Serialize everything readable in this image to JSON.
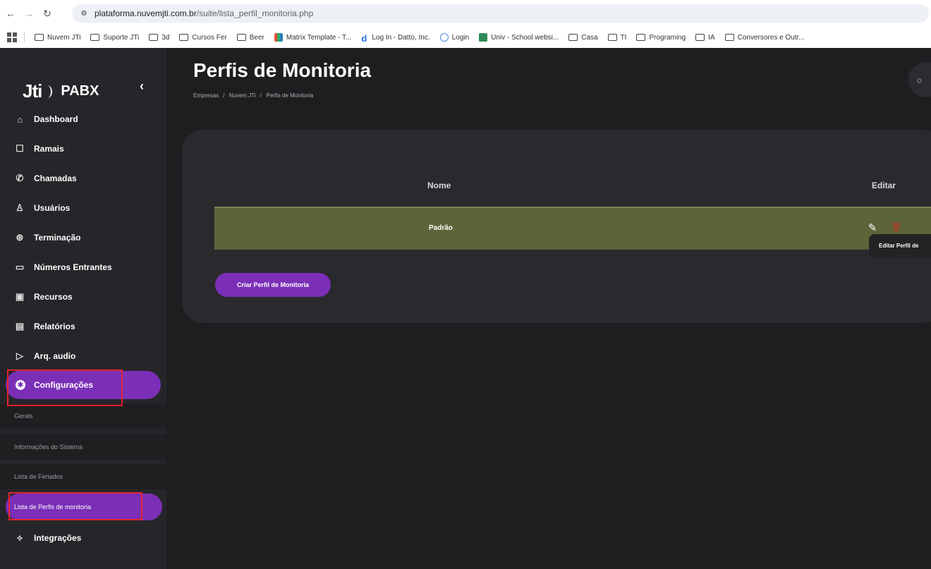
{
  "browser": {
    "url_host": "plataforma.nuvemjti.com.br",
    "url_path": "/suite/lista_perfil_monitoria.php",
    "bookmarks": [
      {
        "label": "Nuvem JTi",
        "icon": "folder-icon"
      },
      {
        "label": "Suporte JTi",
        "icon": "folder-icon"
      },
      {
        "label": "3d",
        "icon": "folder-icon"
      },
      {
        "label": "Cursos Fer",
        "icon": "folder-icon"
      },
      {
        "label": "Beer",
        "icon": "folder-icon"
      },
      {
        "label": "Matrix Template - T...",
        "icon": "matrix-icon"
      },
      {
        "label": "Log In - Datto, Inc.",
        "icon": "datto-icon"
      },
      {
        "label": "Login",
        "icon": "search-icon"
      },
      {
        "label": "Univ - School websi...",
        "icon": "univ-icon"
      },
      {
        "label": "Casa",
        "icon": "folder-icon"
      },
      {
        "label": "TI",
        "icon": "folder-icon"
      },
      {
        "label": "Programing",
        "icon": "folder-icon"
      },
      {
        "label": "IA",
        "icon": "folder-icon"
      },
      {
        "label": "Conversores e Outr...",
        "icon": "folder-icon"
      }
    ]
  },
  "sidebar": {
    "logo_mark": "Jti",
    "logo_text": "PABX",
    "collapse_glyph": "‹",
    "items": [
      {
        "label": "Dashboard",
        "icon": "⌂"
      },
      {
        "label": "Ramais",
        "icon": "☐"
      },
      {
        "label": "Chamadas",
        "icon": "✆"
      },
      {
        "label": "Usuários",
        "icon": "♙"
      },
      {
        "label": "Terminação",
        "icon": "⊛"
      },
      {
        "label": "Números Entrantes",
        "icon": "▭"
      },
      {
        "label": "Recursos",
        "icon": "▣"
      },
      {
        "label": "Relatórios",
        "icon": "▤"
      },
      {
        "label": "Arq. audio",
        "icon": "▷"
      },
      {
        "label": "Configurações",
        "icon": "✱"
      }
    ],
    "sub_items": [
      {
        "label": "Gerais"
      },
      {
        "label": "Informações do Sistema"
      },
      {
        "label": "Lista de Feriados"
      },
      {
        "label": "Lista de Perfis de monitoria"
      }
    ],
    "integracoes": {
      "label": "Integrações",
      "icon": "⟡"
    }
  },
  "header": {
    "title": "Perfis de Monitoria",
    "breadcrumb": [
      "Empresas",
      "/",
      "Nuvem JTi",
      "/",
      "Perfis de Monitoria"
    ],
    "theme_icon": "☼"
  },
  "table": {
    "columns": [
      "Nome",
      "Editar"
    ],
    "rows": [
      {
        "nome": "Padrão"
      }
    ],
    "edit_tooltip": "Editar Perfil de"
  },
  "actions": {
    "create_label": "Criar Perfil de Monitoria"
  },
  "colors": {
    "accent": "#7b2fb7",
    "row_bg": "#5e6439",
    "highlight": "#e3242b"
  }
}
